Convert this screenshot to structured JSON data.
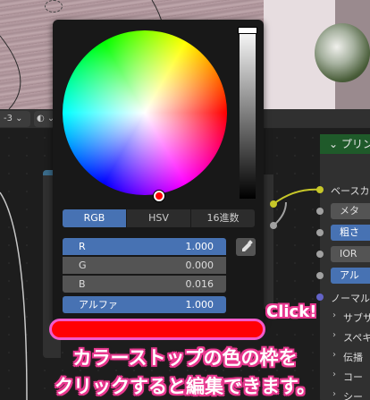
{
  "viewport_header": {
    "frame_dropdown": "-3",
    "shading_icon": "sphere-shading-icon"
  },
  "color_picker": {
    "hue_wheel_selection": {
      "hue_deg": 0,
      "saturation": 1.0
    },
    "value_level": 1.0,
    "tabs": [
      {
        "label": "RGB",
        "active": true
      },
      {
        "label": "HSV",
        "active": false
      },
      {
        "label": "16進数",
        "active": false
      }
    ],
    "channels": [
      {
        "label": "R",
        "value": "1.000"
      },
      {
        "label": "G",
        "value": "0.000"
      },
      {
        "label": "B",
        "value": "0.016"
      },
      {
        "label": "アルファ",
        "value": "1.000"
      }
    ],
    "eyedropper_icon": "eyedropper-icon"
  },
  "color_stop": {
    "color": "#ff0004",
    "outline_color": "#f25acb"
  },
  "principled_node": {
    "title": "プリン",
    "rows": {
      "base": "ベースカ",
      "metal": "メタ",
      "rough": "粗さ",
      "ior": "IOR",
      "alpha": "アル",
      "normal": "ノーマル",
      "subsurface": "サブサ",
      "specular": "スペキ",
      "transmission": "伝播",
      "coat": "コー",
      "sheen": "シー"
    }
  },
  "annotation": {
    "click": "Click!",
    "caption_line1": "カラーストップの色の枠を",
    "caption_line2": "クリックすると編集できます。",
    "accent": "#e8388f"
  }
}
